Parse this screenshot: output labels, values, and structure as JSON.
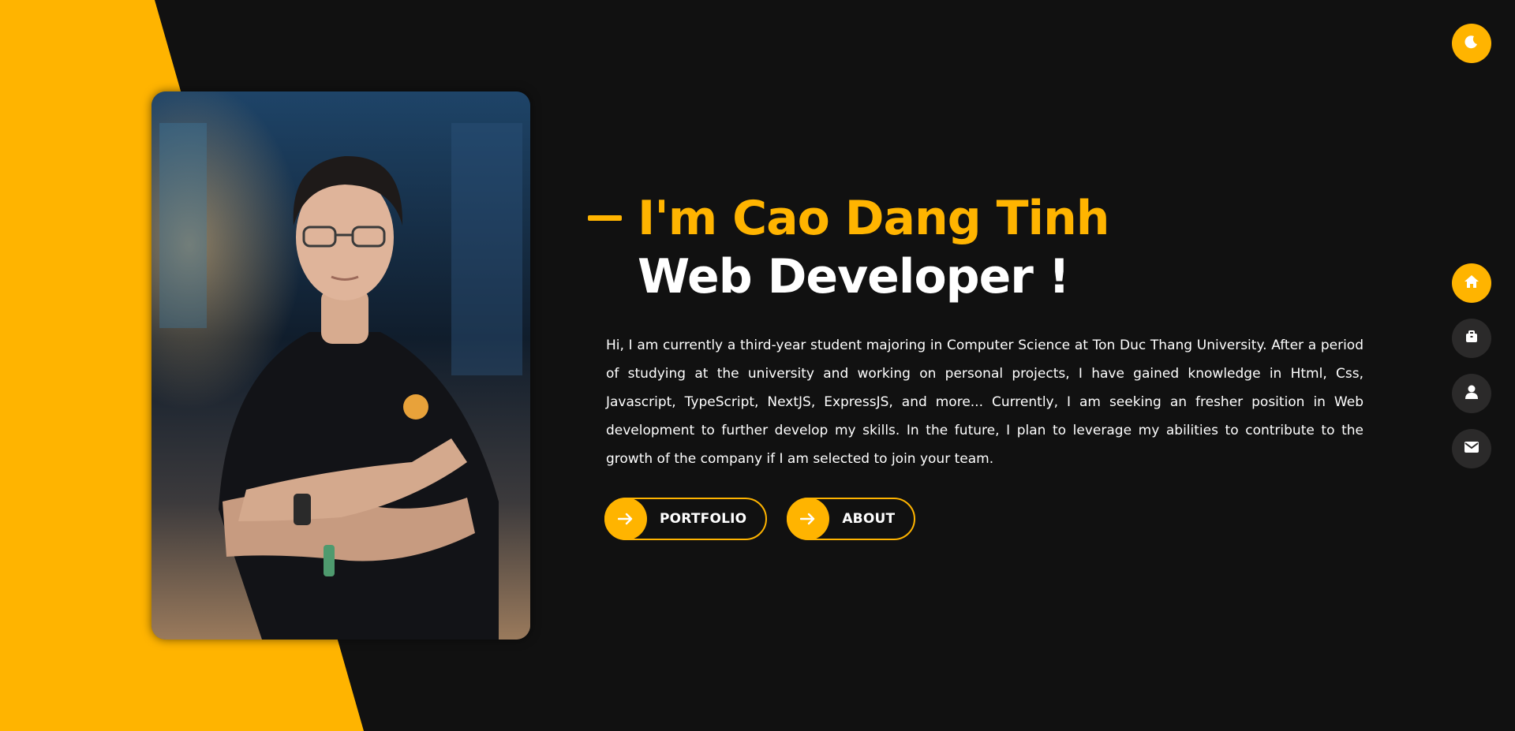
{
  "colors": {
    "accent": "#ffb400",
    "background": "#111111",
    "nav_button_bg": "#2b2a2a",
    "text": "#ffffff"
  },
  "hero": {
    "title_line_1": "I'm Cao Dang Tinh",
    "title_line_2": "Web Developer !",
    "description": "Hi, I am currently a third-year student majoring in Computer Science at Ton Duc Thang University. After a period of studying at the university and working on personal projects, I have gained knowledge in Html, Css, Javascript, TypeScript, NextJS, ExpressJS, and more... Currently, I am seeking an fresher position in Web development to further develop my skills. In the future, I plan to leverage my abilities to contribute to the growth of the company if I am selected to join your team.",
    "buttons": [
      {
        "label": "PORTFOLIO",
        "icon": "arrow-right-icon"
      },
      {
        "label": "ABOUT",
        "icon": "arrow-right-icon"
      }
    ]
  },
  "theme_toggle": {
    "icon": "moon-icon"
  },
  "side_nav": {
    "items": [
      {
        "icon": "home-icon",
        "active": true
      },
      {
        "icon": "briefcase-icon",
        "active": false
      },
      {
        "icon": "user-icon",
        "active": false
      },
      {
        "icon": "mail-icon",
        "active": false
      }
    ]
  }
}
